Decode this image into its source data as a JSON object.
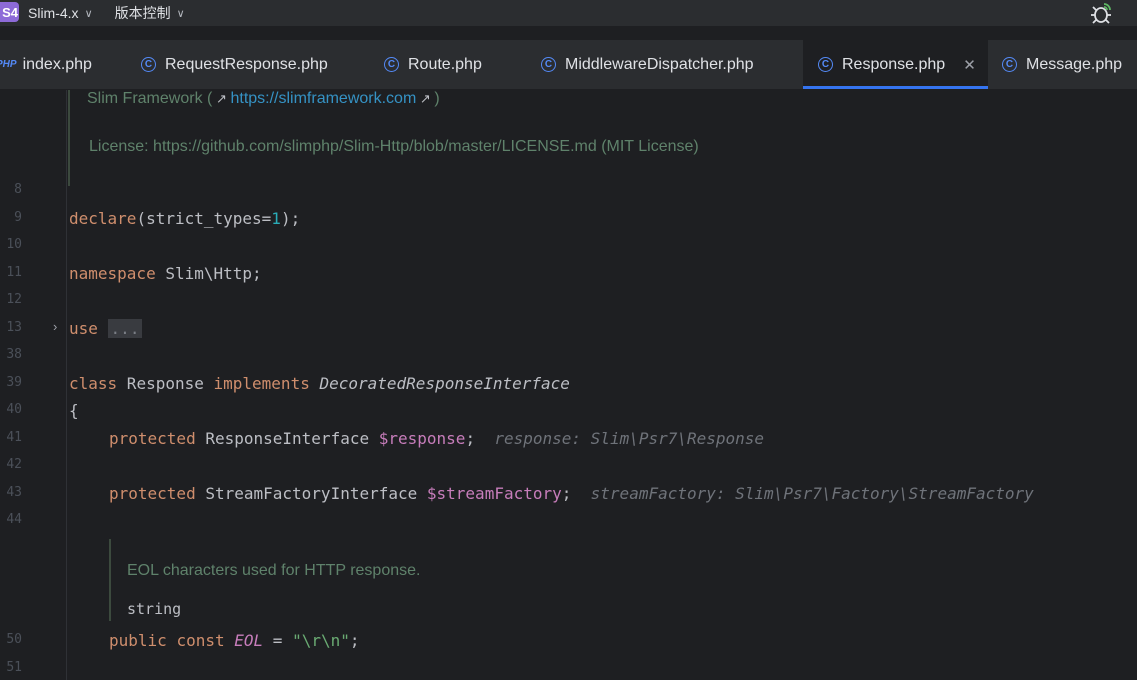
{
  "titlebar": {
    "project_badge": "S4",
    "project_name": "Slim-4.x",
    "vcs_label": "版本控制"
  },
  "tabs": [
    {
      "label": "index.php",
      "icon": "php-file-icon"
    },
    {
      "label": "RequestResponse.php",
      "icon": "class-icon"
    },
    {
      "label": "Route.php",
      "icon": "class-icon"
    },
    {
      "label": "MiddlewareDispatcher.php",
      "icon": "class-icon"
    },
    {
      "label": "Response.php",
      "icon": "class-icon",
      "active": true
    },
    {
      "label": "Message.php",
      "icon": "class-icon"
    }
  ],
  "doc_header": {
    "framework_text": "Slim Framework (",
    "framework_link": "https://slimframework.com",
    "framework_close": ")",
    "license_text": "License: https://github.com/slimphp/Slim-Http/blob/master/LICENSE.md (MIT License)"
  },
  "line_numbers": [
    "8",
    "9",
    "10",
    "11",
    "12",
    "13",
    "38",
    "39",
    "40",
    "41",
    "42",
    "43",
    "44",
    "50",
    "51"
  ],
  "code": {
    "declare_kw": "declare",
    "declare_rest_a": "(strict_types=",
    "declare_num": "1",
    "declare_rest_b": ");",
    "namespace_kw": "namespace",
    "namespace_name": " Slim\\Http;",
    "use_kw": "use",
    "use_folded": "...",
    "class_kw": "class",
    "class_name": " Response ",
    "implements_kw": "implements",
    "interface_name": "DecoratedResponseInterface",
    "brace_open": "{",
    "prop1_kw": "protected",
    "prop1_type": " ResponseInterface ",
    "prop1_var": "$response",
    "prop1_semi": ";",
    "prop1_hint": "response: Slim\\Psr7\\Response",
    "prop2_kw": "protected",
    "prop2_type": " StreamFactoryInterface ",
    "prop2_var": "$streamFactory",
    "prop2_semi": ";",
    "prop2_hint": "streamFactory: Slim\\Psr7\\Factory\\StreamFactory",
    "doc_eol": "EOL characters used for HTTP response.",
    "doc_type": "string",
    "const_kw1": "public",
    "const_kw2": "const",
    "const_name": "EOL",
    "const_eq": " = ",
    "const_value": "\"\\r\\n\"",
    "const_semi": ";"
  }
}
